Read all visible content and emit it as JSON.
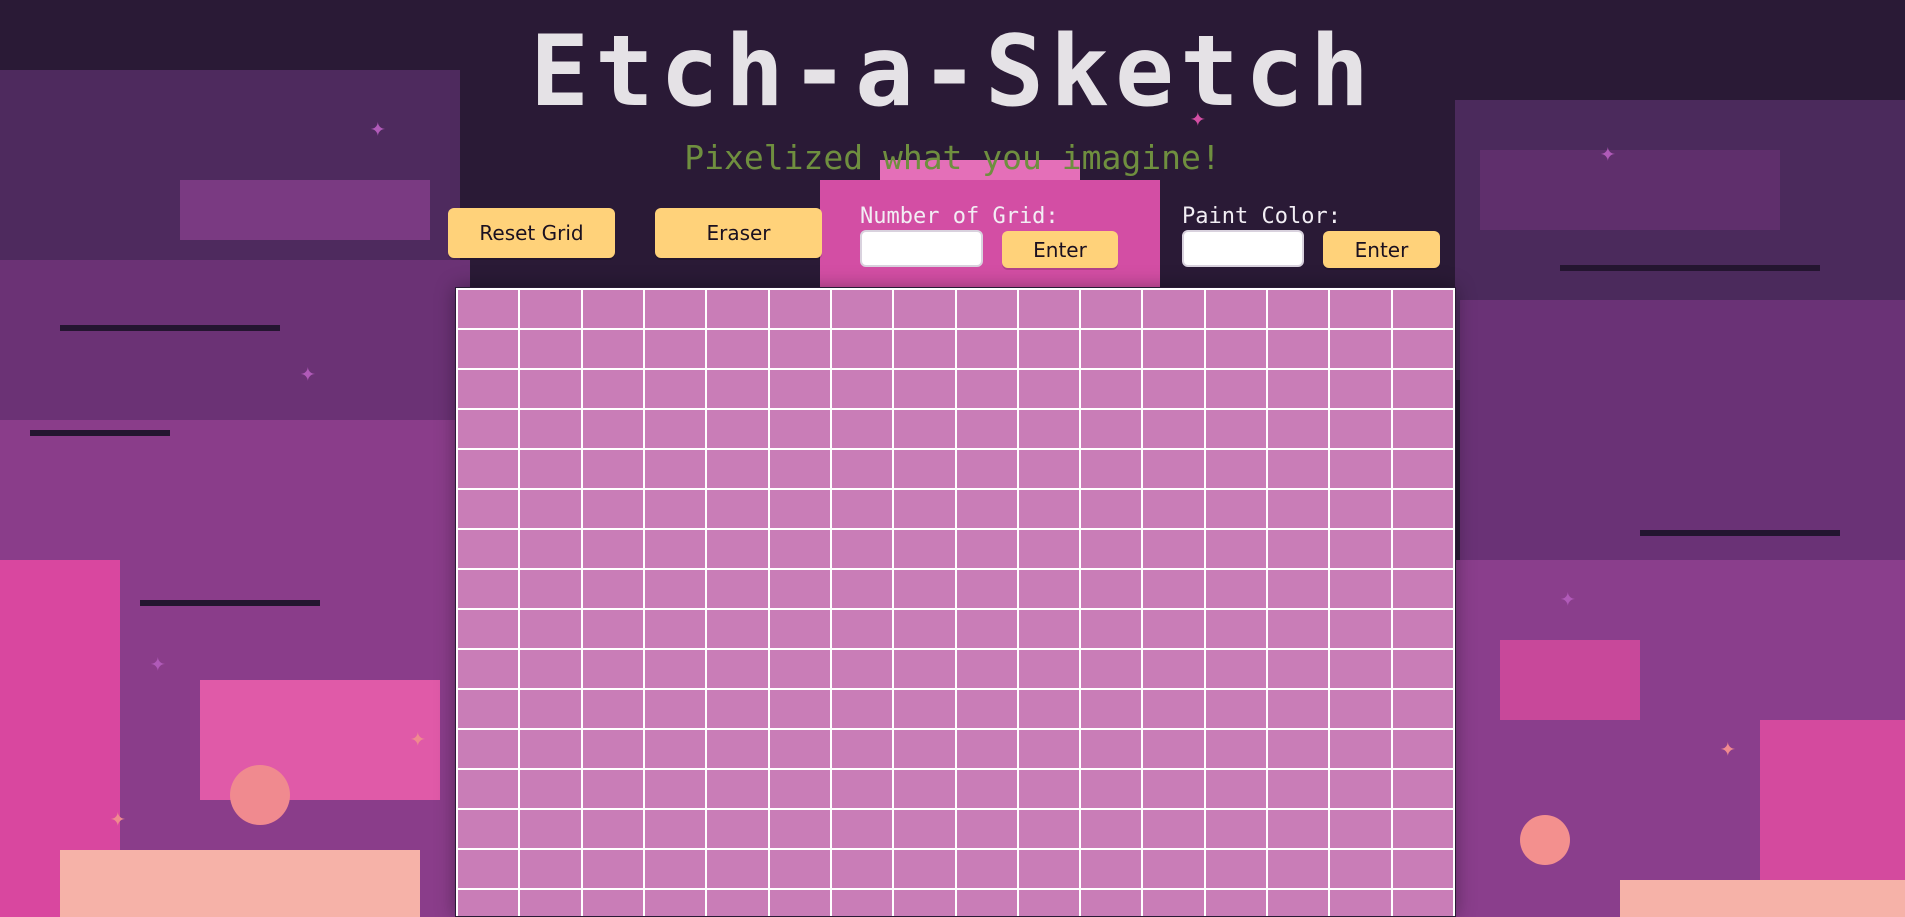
{
  "header": {
    "title": "Etch-a-Sketch",
    "subtitle": "Pixelized what you imagine!"
  },
  "controls": {
    "reset_label": "Reset Grid",
    "eraser_label": "Eraser",
    "grid_number_label": "Number of Grid:",
    "grid_number_value": "",
    "grid_enter_label": "Enter",
    "paint_color_label": "Paint Color:",
    "paint_color_value": "",
    "color_enter_label": "Enter"
  },
  "grid": {
    "columns": 16,
    "cell_color": "#c97db7",
    "line_color": "#ffffff"
  },
  "colors": {
    "button": "#ffd27a",
    "title": "#e5e2e6",
    "subtitle": "#6f8f3f"
  }
}
